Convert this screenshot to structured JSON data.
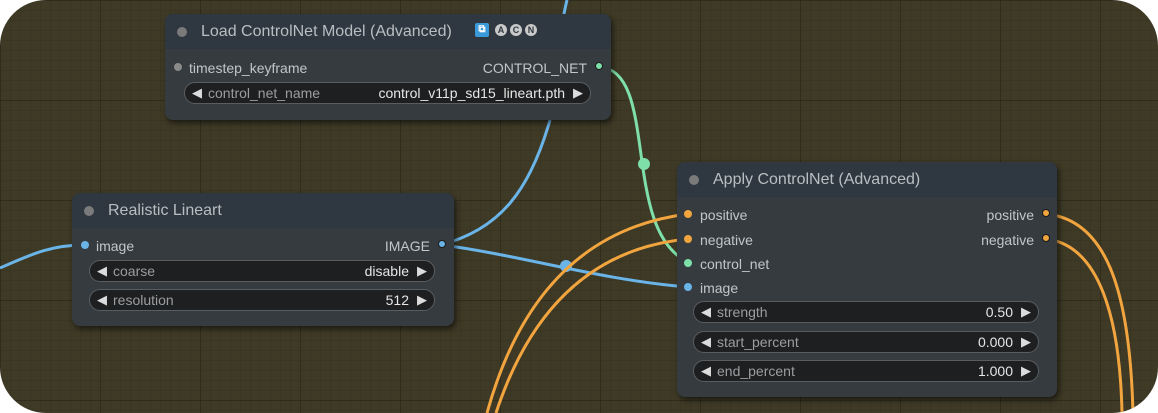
{
  "colors": {
    "canvas": "#3e3a26",
    "node_body": "#353b3f",
    "node_header": "#2f3840",
    "link_image": "#6ab4e8",
    "link_control_net": "#7ee0a8",
    "link_conditioning": "#f2a53f",
    "widget_bg": "#1e1f20"
  },
  "nodes": {
    "load_controlnet": {
      "title": "Load ControlNet Model (Advanced)",
      "badge_icon": "puzzle-icon",
      "badges": [
        "A",
        "C",
        "N"
      ],
      "inputs": [
        {
          "label": "timestep_keyframe",
          "type": "TIMESTEP_KEYFRAME"
        }
      ],
      "outputs": [
        {
          "label": "CONTROL_NET",
          "type": "CONTROL_NET"
        }
      ],
      "widgets": [
        {
          "label": "control_net_name",
          "value": "control_v11p_sd15_lineart.pth"
        }
      ]
    },
    "realistic_lineart": {
      "title": "Realistic Lineart",
      "inputs": [
        {
          "label": "image",
          "type": "IMAGE"
        }
      ],
      "outputs": [
        {
          "label": "IMAGE",
          "type": "IMAGE"
        }
      ],
      "widgets": [
        {
          "label": "coarse",
          "value": "disable"
        },
        {
          "label": "resolution",
          "value": "512"
        }
      ]
    },
    "apply_controlnet": {
      "title": "Apply ControlNet (Advanced)",
      "inputs": [
        {
          "label": "positive",
          "type": "CONDITIONING"
        },
        {
          "label": "negative",
          "type": "CONDITIONING"
        },
        {
          "label": "control_net",
          "type": "CONTROL_NET"
        },
        {
          "label": "image",
          "type": "IMAGE"
        }
      ],
      "outputs": [
        {
          "label": "positive",
          "type": "CONDITIONING"
        },
        {
          "label": "negative",
          "type": "CONDITIONING"
        }
      ],
      "widgets": [
        {
          "label": "strength",
          "value": "0.50"
        },
        {
          "label": "start_percent",
          "value": "0.000"
        },
        {
          "label": "end_percent",
          "value": "1.000"
        }
      ]
    }
  },
  "widget_arrows": {
    "left": "◀",
    "right": "▶"
  }
}
